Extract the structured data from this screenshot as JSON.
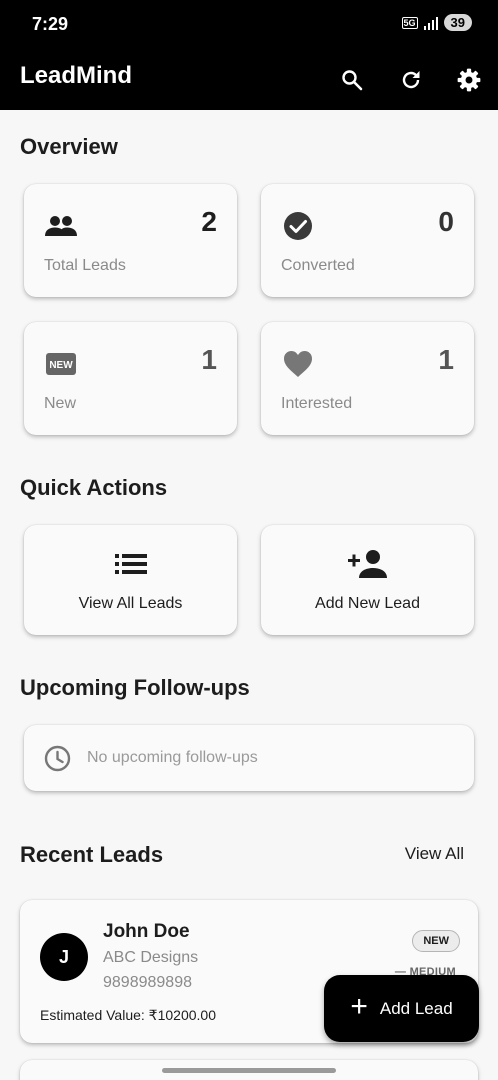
{
  "status_bar": {
    "time": "7:29",
    "network": "5G",
    "battery": "39"
  },
  "app_bar": {
    "title": "LeadMind",
    "actions": [
      {
        "name": "search",
        "icon": "search-icon"
      },
      {
        "name": "refresh",
        "icon": "refresh-icon"
      },
      {
        "name": "settings",
        "icon": "gear-icon"
      }
    ]
  },
  "overview": {
    "title": "Overview",
    "stats": [
      {
        "label": "Total Leads",
        "value": "2",
        "icon": "group-icon"
      },
      {
        "label": "Converted",
        "value": "0",
        "icon": "check-circle-icon"
      },
      {
        "label": "New",
        "value": "1",
        "icon": "new-badge-icon"
      },
      {
        "label": "Interested",
        "value": "1",
        "icon": "heart-icon"
      }
    ]
  },
  "quick_actions": {
    "title": "Quick Actions",
    "items": [
      {
        "label": "View All Leads",
        "icon": "list-icon"
      },
      {
        "label": "Add New Lead",
        "icon": "person-add-icon"
      }
    ]
  },
  "followups": {
    "title": "Upcoming Follow-ups",
    "empty_text": "No upcoming follow-ups",
    "icon": "clock-icon"
  },
  "recent_leads": {
    "title": "Recent Leads",
    "view_all_label": "View All",
    "leads": [
      {
        "initial": "J",
        "name": "John Doe",
        "company": "ABC Designs",
        "phone": "9898989898",
        "estimated_value": "Estimated Value: ₹10200.00",
        "status": "NEW",
        "priority": "— MEDIUM"
      }
    ]
  },
  "fab": {
    "label": "Add Lead",
    "icon": "plus-icon"
  },
  "colors": {
    "app_bar": "#000000",
    "background": "#f7f7f7",
    "card": "#fafafa",
    "accent": "#000000"
  }
}
